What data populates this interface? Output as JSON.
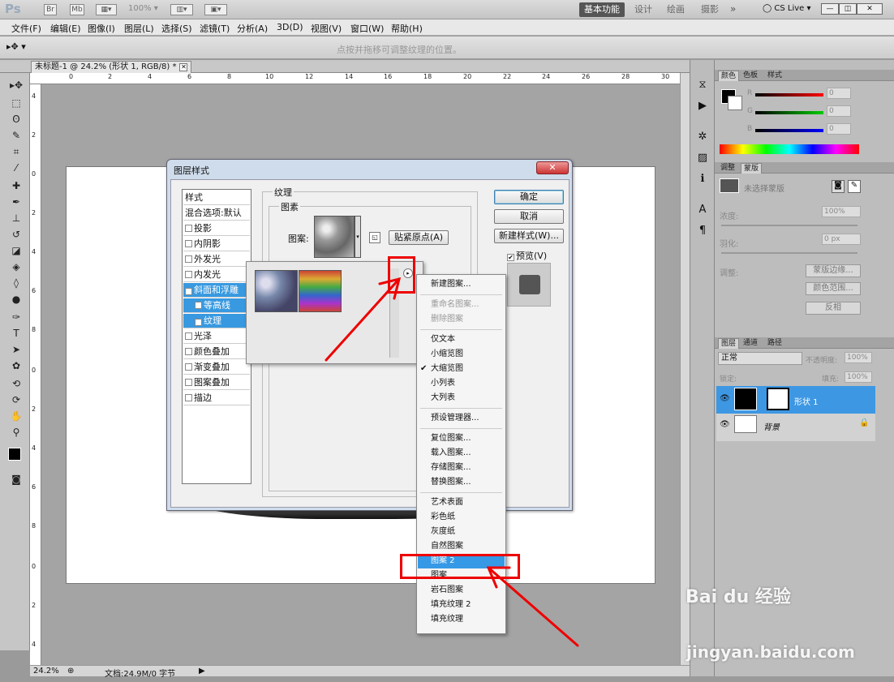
{
  "app": {
    "logo": "Ps",
    "zoom_value": "100%",
    "workspaces": [
      "基本功能",
      "设计",
      "绘画",
      "摄影"
    ],
    "cslive": "CS Live"
  },
  "menubar": [
    "文件(F)",
    "编辑(E)",
    "图像(I)",
    "图层(L)",
    "选择(S)",
    "滤镜(T)",
    "分析(A)",
    "3D(D)",
    "视图(V)",
    "窗口(W)",
    "帮助(H)"
  ],
  "options_bar": {
    "hint": "点按并拖移可调整纹理的位置。"
  },
  "document": {
    "tab_title": "未标题-1 @ 24.2% (形状 1, RGB/8) *",
    "ruler_h": [
      "0",
      "2",
      "4",
      "6",
      "8",
      "10",
      "12",
      "14",
      "16",
      "18",
      "20",
      "22",
      "24",
      "26",
      "28",
      "30"
    ],
    "ruler_v": [
      "4",
      "2",
      "0",
      "2",
      "4",
      "6",
      "8",
      "0",
      "2",
      "4",
      "6",
      "8",
      "0",
      "2",
      "4"
    ]
  },
  "status": {
    "zoom": "24.2%",
    "doc": "文档:24.9M/0 字节"
  },
  "dialog": {
    "title": "图层样式",
    "style_list": [
      {
        "label": "样式",
        "cb": false,
        "checked": false,
        "sel": false
      },
      {
        "label": "混合选项:默认",
        "cb": false,
        "checked": false,
        "sel": false
      },
      {
        "label": "投影",
        "cb": true,
        "checked": false,
        "sel": false
      },
      {
        "label": "内阴影",
        "cb": true,
        "checked": false,
        "sel": false
      },
      {
        "label": "外发光",
        "cb": true,
        "checked": false,
        "sel": false
      },
      {
        "label": "内发光",
        "cb": true,
        "checked": false,
        "sel": false
      },
      {
        "label": "斜面和浮雕",
        "cb": true,
        "checked": true,
        "sel": true
      },
      {
        "label": "等高线",
        "cb": true,
        "checked": false,
        "sel": true
      },
      {
        "label": "纹理",
        "cb": true,
        "checked": true,
        "sel": true
      },
      {
        "label": "光泽",
        "cb": true,
        "checked": false,
        "sel": false
      },
      {
        "label": "颜色叠加",
        "cb": true,
        "checked": false,
        "sel": false
      },
      {
        "label": "渐变叠加",
        "cb": true,
        "checked": false,
        "sel": false
      },
      {
        "label": "图案叠加",
        "cb": true,
        "checked": false,
        "sel": false
      },
      {
        "label": "描边",
        "cb": true,
        "checked": false,
        "sel": false
      }
    ],
    "texture_group": "纹理",
    "pattern_group": "图素",
    "pattern_label": "图案:",
    "snap_button": "贴紧原点(A)",
    "ok": "确定",
    "cancel": "取消",
    "new_style": "新建样式(W)...",
    "preview": "预览(V)"
  },
  "menu": {
    "items": [
      {
        "label": "新建图案...",
        "dis": false,
        "chk": false,
        "hl": false
      },
      {
        "sep": true
      },
      {
        "label": "重命名图案...",
        "dis": true,
        "chk": false,
        "hl": false
      },
      {
        "label": "删除图案",
        "dis": true,
        "chk": false,
        "hl": false
      },
      {
        "sep": true
      },
      {
        "label": "仅文本",
        "dis": false,
        "chk": false,
        "hl": false
      },
      {
        "label": "小缩览图",
        "dis": false,
        "chk": false,
        "hl": false
      },
      {
        "label": "大缩览图",
        "dis": false,
        "chk": true,
        "hl": false
      },
      {
        "label": "小列表",
        "dis": false,
        "chk": false,
        "hl": false
      },
      {
        "label": "大列表",
        "dis": false,
        "chk": false,
        "hl": false
      },
      {
        "sep": true
      },
      {
        "label": "预设管理器...",
        "dis": false,
        "chk": false,
        "hl": false
      },
      {
        "sep": true
      },
      {
        "label": "复位图案...",
        "dis": false,
        "chk": false,
        "hl": false
      },
      {
        "label": "载入图案...",
        "dis": false,
        "chk": false,
        "hl": false
      },
      {
        "label": "存储图案...",
        "dis": false,
        "chk": false,
        "hl": false
      },
      {
        "label": "替换图案...",
        "dis": false,
        "chk": false,
        "hl": false
      },
      {
        "sep": true
      },
      {
        "label": "艺术表面",
        "dis": false,
        "chk": false,
        "hl": false
      },
      {
        "label": "彩色纸",
        "dis": false,
        "chk": false,
        "hl": false
      },
      {
        "label": "灰度纸",
        "dis": false,
        "chk": false,
        "hl": false
      },
      {
        "label": "自然图案",
        "dis": false,
        "chk": false,
        "hl": false
      },
      {
        "label": "图案 2",
        "dis": false,
        "chk": false,
        "hl": true
      },
      {
        "label": "图案",
        "dis": false,
        "chk": false,
        "hl": false
      },
      {
        "label": "岩石图案",
        "dis": false,
        "chk": false,
        "hl": false
      },
      {
        "label": "填充纹理 2",
        "dis": false,
        "chk": false,
        "hl": false
      },
      {
        "label": "填充纹理",
        "dis": false,
        "chk": false,
        "hl": false
      }
    ],
    "check_mark": "✔"
  },
  "color_panel": {
    "tabs": [
      "颜色",
      "色板",
      "样式"
    ],
    "channels": [
      {
        "label": "R",
        "value": "0"
      },
      {
        "label": "G",
        "value": "0"
      },
      {
        "label": "B",
        "value": "0"
      }
    ]
  },
  "adjust_panel": {
    "tabs": [
      "调整",
      "蒙版"
    ],
    "mask_label": "未选择蒙版",
    "density": "浓度:",
    "density_val": "100%",
    "feather": "羽化:",
    "feather_val": "0 px",
    "refine": "调整:",
    "btns": [
      "蒙版边缘...",
      "颜色范围...",
      "反相"
    ]
  },
  "layers_panel": {
    "tabs": [
      "图层",
      "通道",
      "路径"
    ],
    "blend": "正常",
    "opacity_label": "不透明度:",
    "opacity": "100%",
    "lock_label": "锁定:",
    "fill_label": "填充:",
    "fill": "100%",
    "layers": [
      {
        "name": "形状 1",
        "sel": true
      },
      {
        "name": "背景",
        "sel": false
      }
    ]
  },
  "watermark": {
    "brand": "Bai du 经验",
    "url": "jingyan.baidu.com"
  }
}
